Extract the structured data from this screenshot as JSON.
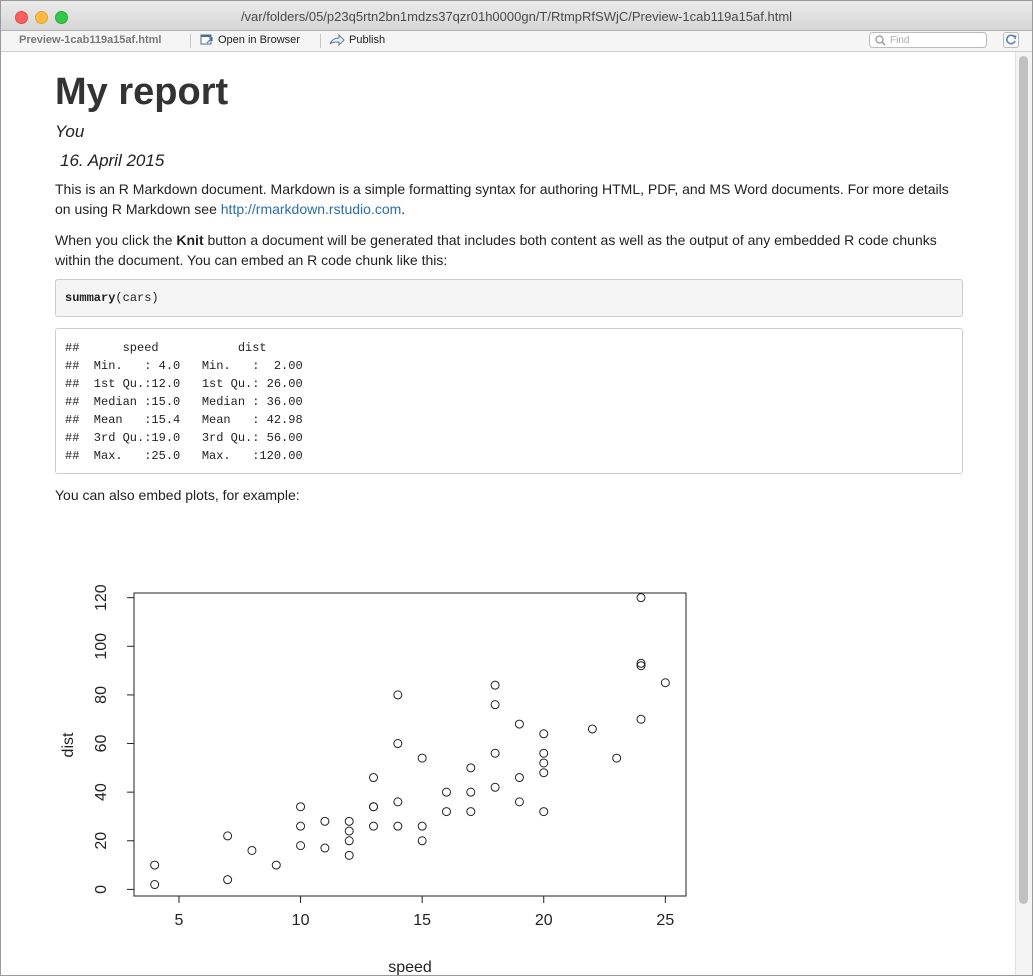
{
  "window": {
    "title": "/var/folders/05/p23q5rtn2bn1mdzs37qzr01h0000gn/T/RtmpRfSWjC/Preview-1cab119a15af.html"
  },
  "toolbar": {
    "file_label": "Preview-1cab119a15af.html",
    "open_label": "Open in Browser",
    "publish_label": "Publish",
    "find_placeholder": "Find"
  },
  "doc": {
    "title": "My report",
    "author": "You",
    "date": "16.  April 2015",
    "p1_text": "This is an R Markdown document. Markdown is a simple formatting syntax for authoring HTML, PDF, and MS Word documents. For more details on using R Markdown see ",
    "p1_link": "http://rmarkdown.rstudio.com",
    "p1_end": ".",
    "p2_pre": "When you click the ",
    "p2_bold": "Knit",
    "p2_post": " button a document will be generated that includes both content as well as the output of any embedded R code chunks within the document. You can embed an R code chunk like this:",
    "code_fn": "summary",
    "code_arg": "(cars)",
    "output_lines": [
      "##      speed           dist       ",
      "##  Min.   : 4.0   Min.   :  2.00  ",
      "##  1st Qu.:12.0   1st Qu.: 26.00  ",
      "##  Median :15.0   Median : 36.00  ",
      "##  Mean   :15.4   Mean   : 42.98  ",
      "##  3rd Qu.:19.0   3rd Qu.: 56.00  ",
      "##  Max.   :25.0   Max.   :120.00  "
    ],
    "p3": "You can also embed plots, for example:"
  },
  "chart_data": {
    "type": "scatter",
    "xlabel": "speed",
    "ylabel": "dist",
    "xlim": [
      3.15,
      25.85
    ],
    "ylim": [
      -2.72,
      121.92
    ],
    "xticks": [
      5,
      10,
      15,
      20,
      25
    ],
    "yticks": [
      0,
      20,
      40,
      60,
      80,
      100,
      120
    ],
    "grid": false,
    "series": [
      {
        "x": [
          4,
          4,
          7,
          7,
          8,
          9,
          10,
          10,
          10,
          11,
          11,
          12,
          12,
          12,
          12,
          13,
          13,
          13,
          13,
          14,
          14,
          14,
          14,
          15,
          15,
          15,
          16,
          16,
          17,
          17,
          17,
          18,
          18,
          18,
          18,
          19,
          19,
          19,
          20,
          20,
          20,
          20,
          20,
          22,
          23,
          24,
          24,
          24,
          24,
          25
        ],
        "y": [
          2,
          10,
          4,
          22,
          16,
          10,
          18,
          26,
          34,
          17,
          28,
          14,
          20,
          24,
          28,
          26,
          34,
          34,
          46,
          26,
          36,
          60,
          80,
          20,
          26,
          54,
          32,
          40,
          32,
          40,
          50,
          42,
          56,
          76,
          84,
          36,
          46,
          68,
          32,
          48,
          52,
          56,
          64,
          66,
          54,
          70,
          92,
          93,
          120,
          85
        ]
      }
    ]
  }
}
